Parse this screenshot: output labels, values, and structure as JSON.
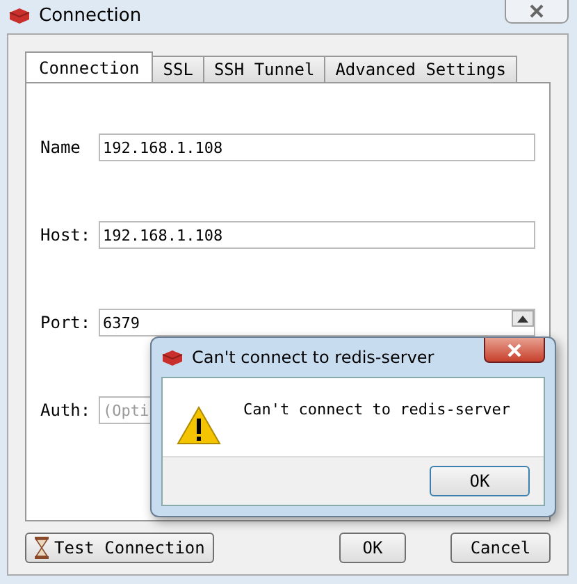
{
  "window": {
    "title": "Connection"
  },
  "tabs": [
    {
      "label": "Connection",
      "selected": true
    },
    {
      "label": "SSL",
      "selected": false
    },
    {
      "label": "SSH Tunnel",
      "selected": false
    },
    {
      "label": "Advanced Settings",
      "selected": false
    }
  ],
  "fields": [
    {
      "label": "Name",
      "value": "192.168.1.108",
      "kind": "text"
    },
    {
      "label": "Host:",
      "value": "192.168.1.108",
      "kind": "text"
    },
    {
      "label": "Port:",
      "value": "6379",
      "kind": "spin"
    },
    {
      "label": "Auth:",
      "placeholder": "(Opti",
      "kind": "text"
    }
  ],
  "buttons": [
    "Test Connection",
    "OK",
    "Cancel"
  ],
  "dialog": {
    "title": "Can't connect to redis-server",
    "message": "Can't connect to redis-server",
    "button": "OK"
  }
}
